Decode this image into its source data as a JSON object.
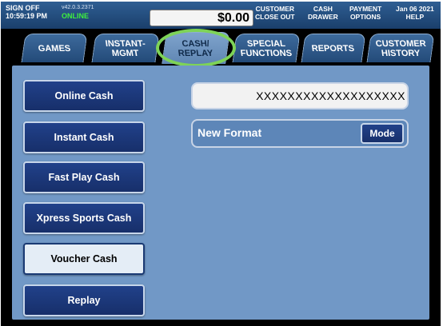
{
  "status": {
    "signoff_label": "SIGN OFF",
    "time": "10:59:19 PM",
    "version": "v42.0.3.2371",
    "online": "ONLINE",
    "amount": "$0.00",
    "date": "Jan 06 2021"
  },
  "topbar": {
    "customer_close_out": [
      "CUSTOMER",
      "CLOSE OUT"
    ],
    "cash_drawer": [
      "CASH",
      "DRAWER"
    ],
    "payment_options": [
      "PAYMENT",
      "OPTIONS"
    ],
    "help": "HELP"
  },
  "tabs": [
    {
      "line1": "GAMES",
      "line2": ""
    },
    {
      "line1": "INSTANT-",
      "line2": "MGMT"
    },
    {
      "line1": "CASH/",
      "line2": "REPLAY"
    },
    {
      "line1": "SPECIAL",
      "line2": "FUNCTIONS"
    },
    {
      "line1": "REPORTS",
      "line2": ""
    },
    {
      "line1": "CUSTOMER",
      "line2": "HISTORY"
    }
  ],
  "active_tab": "CASH/ REPLAY",
  "sidebar": {
    "buttons": [
      {
        "label": "Online Cash"
      },
      {
        "label": "Instant Cash"
      },
      {
        "label": "Fast Play Cash"
      },
      {
        "label": "Xpress Sports Cash"
      },
      {
        "label": "Voucher Cash",
        "selected": true
      },
      {
        "label": "Replay"
      }
    ]
  },
  "main": {
    "input_value": "XXXXXXXXXXXXXXXXXXX",
    "format_label": "New Format",
    "mode_label": "Mode"
  },
  "colors": {
    "panel": "#7198c6",
    "button": "#1f3f86",
    "highlight": "#7ed357",
    "online": "#3ef03e"
  }
}
